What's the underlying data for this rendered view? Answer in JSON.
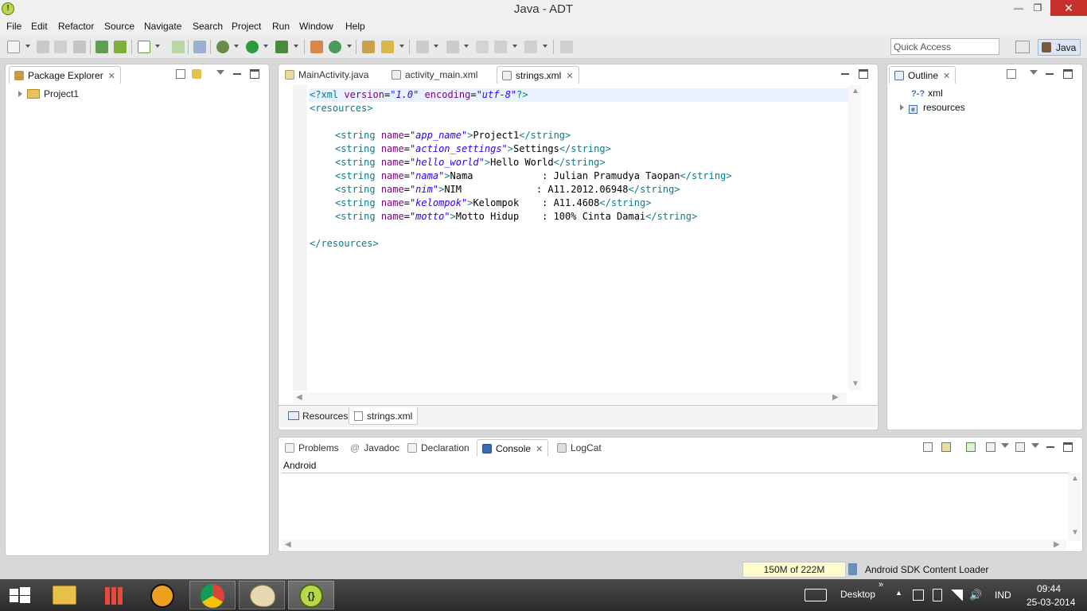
{
  "window": {
    "title": "Java - ADT"
  },
  "menubar": {
    "items": [
      "File",
      "Edit",
      "Refactor",
      "Source",
      "Navigate",
      "Search",
      "Project",
      "Run",
      "Window",
      "Help"
    ]
  },
  "toolbar": {
    "quick_access_placeholder": "Quick Access",
    "perspective_label": "Java"
  },
  "package_explorer": {
    "title": "Package Explorer",
    "items": [
      {
        "label": "Project1"
      }
    ]
  },
  "editor": {
    "tabs": [
      "MainActivity.java",
      "activity_main.xml",
      "strings.xml"
    ],
    "active_tab": "strings.xml",
    "bottom_tabs": [
      "Resources",
      "strings.xml"
    ],
    "code": {
      "l1": [
        "<?",
        "xml",
        " ",
        "version",
        "=",
        "\"1.0\"",
        " ",
        "encoding",
        "=",
        "\"utf-8\"",
        "?>"
      ],
      "l2": [
        "<resources>"
      ],
      "l4": [
        "<string",
        " ",
        "name",
        "=",
        "\"app_name\"",
        ">",
        "Project1",
        "</string>"
      ],
      "l5": [
        "<string",
        " ",
        "name",
        "=",
        "\"action_settings\"",
        ">",
        "Settings",
        "</string>"
      ],
      "l6": [
        "<string",
        " ",
        "name",
        "=",
        "\"hello_world\"",
        ">",
        "Hello World",
        "</string>"
      ],
      "l7": [
        "<string",
        " ",
        "name",
        "=",
        "\"nama\"",
        ">",
        "Nama            : Julian Pramudya Taopan",
        "</string>"
      ],
      "l8": [
        "<string",
        " ",
        "name",
        "=",
        "\"nim\"",
        ">",
        "NIM             : A11.2012.06948",
        "</string>"
      ],
      "l9": [
        "<string",
        " ",
        "name",
        "=",
        "\"kelompok\"",
        ">",
        "Kelompok    : A11.4608",
        "</string>"
      ],
      "l10": [
        "<string",
        " ",
        "name",
        "=",
        "\"motto\"",
        ">",
        "Motto Hidup    : 100% Cinta Damai",
        "</string>"
      ],
      "l12": [
        "</resources>"
      ]
    }
  },
  "outline": {
    "title": "Outline",
    "items": [
      {
        "label": "xml",
        "icon": "?-?"
      },
      {
        "label": "resources",
        "icon": "e"
      }
    ]
  },
  "bottom_panel": {
    "tabs": [
      "Problems",
      "Javadoc",
      "Declaration",
      "Console",
      "LogCat"
    ],
    "active_tab": "Console",
    "console_name": "Android"
  },
  "statusbar": {
    "heap": "150M of 222M",
    "task": "Android SDK Content Loader"
  },
  "taskbar": {
    "desktop_label": "Desktop",
    "more": "»",
    "language": "IND",
    "time": "09:44",
    "date": "25-03-2014"
  },
  "colors": {
    "tag": "#0b7a8a",
    "attr": "#7f007f",
    "value": "#2a00ff",
    "close_button": "#c7312b"
  }
}
